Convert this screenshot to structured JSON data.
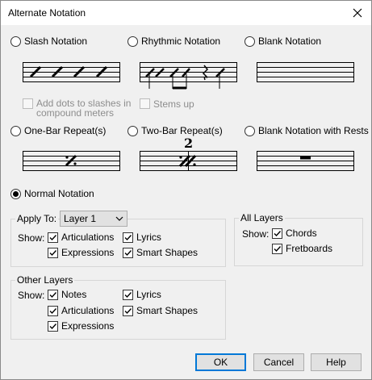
{
  "window": {
    "title": "Alternate Notation"
  },
  "notation_types": [
    {
      "label": "Slash Notation"
    },
    {
      "label": "Rhythmic Notation"
    },
    {
      "label": "Blank Notation"
    },
    {
      "label": "One-Bar Repeat(s)"
    },
    {
      "label": "Two-Bar Repeat(s)"
    },
    {
      "label": "Blank Notation with Rests"
    },
    {
      "label": "Normal Notation"
    }
  ],
  "selected_notation": "Normal Notation",
  "options": {
    "add_dots_line1": "Add dots to slashes in",
    "add_dots_line2": "compound meters",
    "stems_up": "Stems up"
  },
  "two_bar_number": "2",
  "apply_to": {
    "label": "Apply To:",
    "value": "Layer 1",
    "show_label": "Show:",
    "articulations": "Articulations",
    "lyrics": "Lyrics",
    "expressions": "Expressions",
    "smart_shapes": "Smart Shapes"
  },
  "all_layers": {
    "title": "All Layers",
    "show_label": "Show:",
    "chords": "Chords",
    "fretboards": "Fretboards"
  },
  "other_layers": {
    "title": "Other Layers",
    "show_label": "Show:",
    "notes": "Notes",
    "lyrics": "Lyrics",
    "articulations": "Articulations",
    "smart_shapes": "Smart Shapes",
    "expressions": "Expressions"
  },
  "buttons": {
    "ok": "OK",
    "cancel": "Cancel",
    "help": "Help"
  },
  "colors": {
    "accent": "#0078d7",
    "disabled_text": "#8d8d8d"
  }
}
